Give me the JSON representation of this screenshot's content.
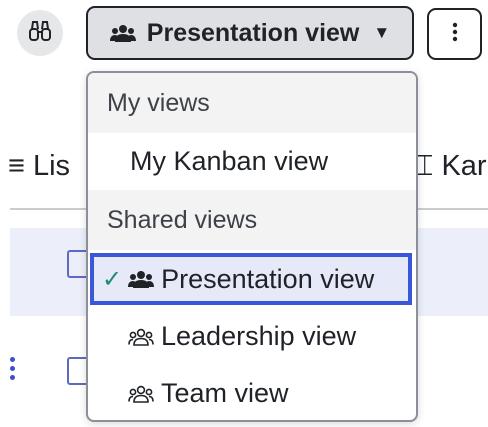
{
  "toolbar": {
    "binoculars_icon": "binoculars-icon",
    "view_selector_label": "Presentation view",
    "view_selector_icon": "group-filled-icon",
    "caret_icon": "caret-down-icon",
    "more_icon": "kebab-icon"
  },
  "background": {
    "tab_left_label": "≡ Lis",
    "tab_right_label": "⌶ Kar"
  },
  "menu": {
    "my_views_header": "My views",
    "my_views": [
      {
        "label": "My Kanban view"
      }
    ],
    "shared_views_header": "Shared views",
    "shared_views": [
      {
        "label": "Presentation view",
        "icon": "group-filled-icon",
        "selected": true,
        "check": "✓"
      },
      {
        "label": "Leadership view",
        "icon": "group-outline-icon",
        "selected": false
      },
      {
        "label": "Team view",
        "icon": "group-outline-icon",
        "selected": false
      }
    ]
  },
  "colors": {
    "accent": "#3b57d9",
    "check": "#1d8a74",
    "selected_bg": "#e6e9f8"
  }
}
